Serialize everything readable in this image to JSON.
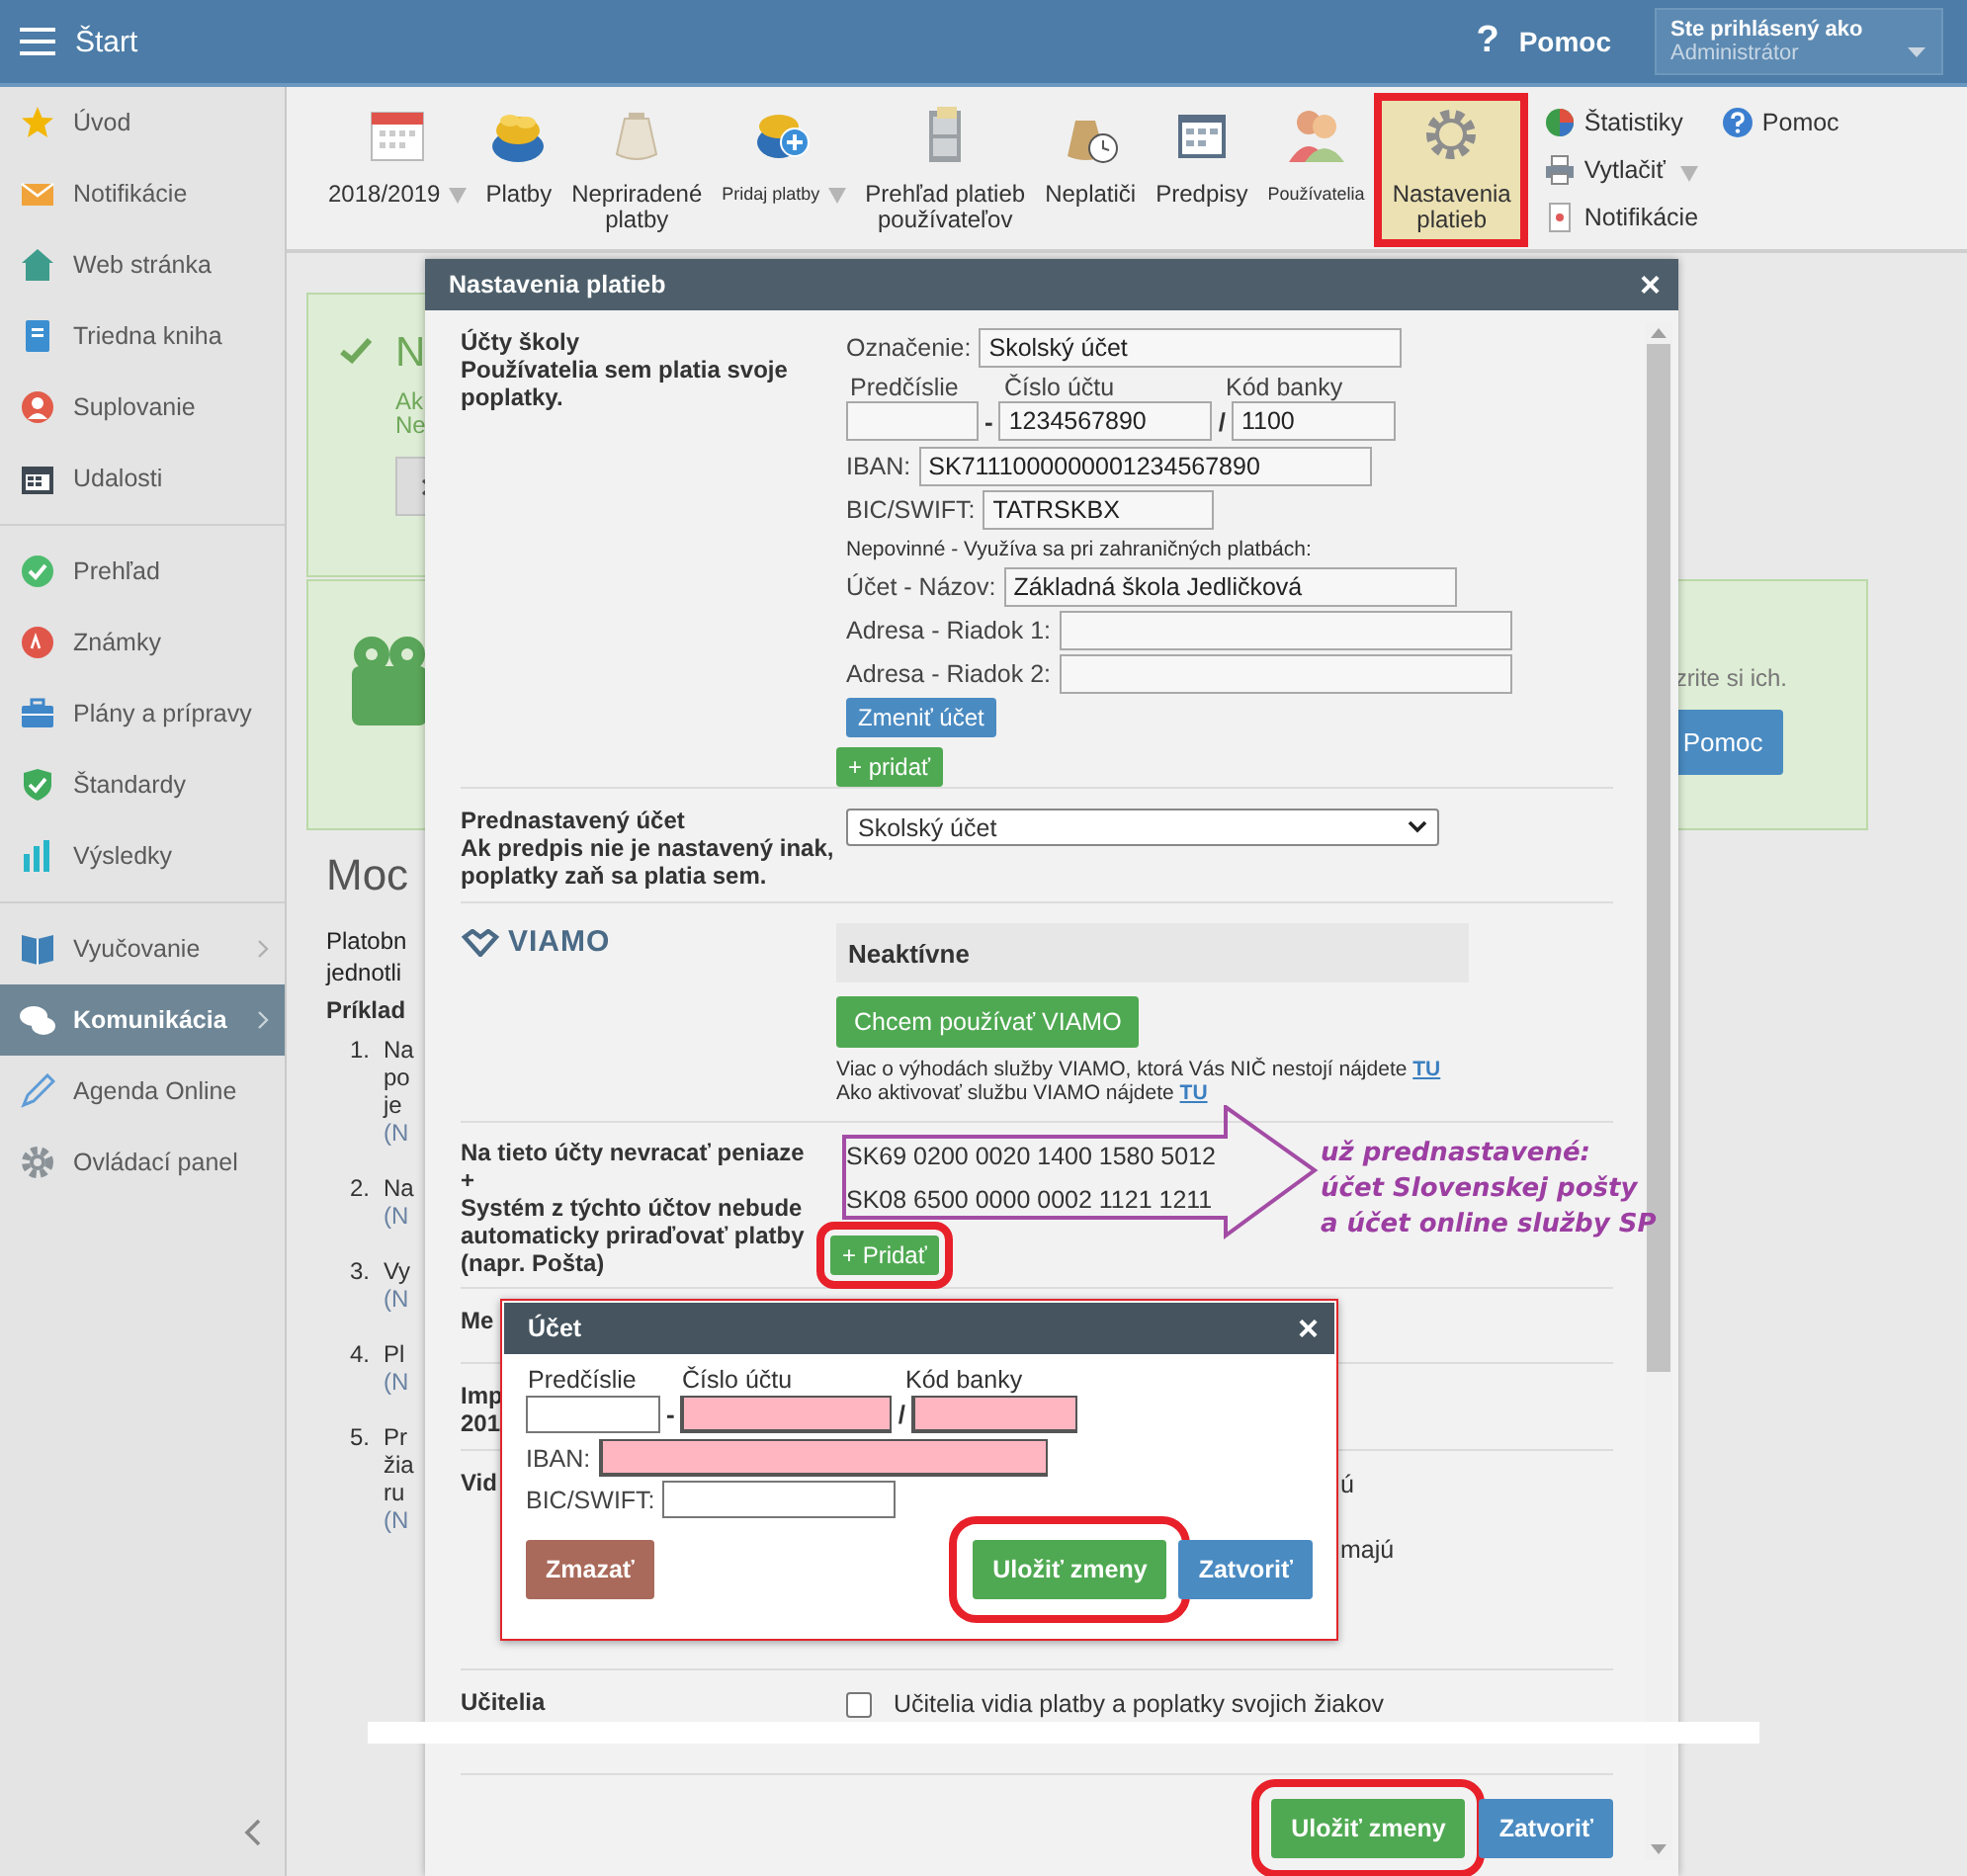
{
  "topbar": {
    "title": "Štart",
    "help_icon": "?",
    "help": "Pomoc",
    "user_label": "Ste prihlásený ako",
    "user_name": "Administrátor"
  },
  "sidebar": {
    "groups": [
      [
        {
          "label": "Úvod",
          "selected": false,
          "expandable": false
        },
        {
          "label": "Notifikácie",
          "selected": false,
          "expandable": false
        },
        {
          "label": "Web stránka",
          "selected": false,
          "expandable": false
        },
        {
          "label": "Triedna kniha",
          "selected": false,
          "expandable": false
        },
        {
          "label": "Suplovanie",
          "selected": false,
          "expandable": false
        },
        {
          "label": "Udalosti",
          "selected": false,
          "expandable": false
        }
      ],
      [
        {
          "label": "Prehľad",
          "selected": false,
          "expandable": false
        },
        {
          "label": "Známky",
          "selected": false,
          "expandable": false
        },
        {
          "label": "Plány a prípravy",
          "selected": false,
          "expandable": false
        },
        {
          "label": "Štandardy",
          "selected": false,
          "expandable": false
        },
        {
          "label": "Výsledky",
          "selected": false,
          "expandable": false
        }
      ],
      [
        {
          "label": "Vyučovanie",
          "selected": false,
          "expandable": true
        },
        {
          "label": "Komunikácia",
          "selected": true,
          "expandable": true
        },
        {
          "label": "Agenda Online",
          "selected": false,
          "expandable": false
        },
        {
          "label": "Ovládací panel",
          "selected": false,
          "expandable": false
        }
      ]
    ]
  },
  "toolbar": {
    "items": [
      {
        "label": "2018/2019",
        "dropdown": true,
        "selected": false,
        "small": false
      },
      {
        "label": "Platby",
        "dropdown": false,
        "selected": false,
        "small": false
      },
      {
        "label": "Nepriradené\nplatby",
        "dropdown": false,
        "selected": false,
        "small": false
      },
      {
        "label": "Pridaj platby",
        "dropdown": true,
        "selected": false,
        "small": true
      },
      {
        "label": "Prehľad platieb\npoužívateľov",
        "dropdown": false,
        "selected": false,
        "small": false
      },
      {
        "label": "Neplatiči",
        "dropdown": false,
        "selected": false,
        "small": false
      },
      {
        "label": "Predpisy",
        "dropdown": false,
        "selected": false,
        "small": false
      },
      {
        "label": "Používatelia",
        "dropdown": false,
        "selected": false,
        "small": true
      },
      {
        "label": "Nastavenia\nplatieb",
        "dropdown": false,
        "selected": true,
        "small": false
      }
    ],
    "side_items": [
      {
        "label": "Štatistiky",
        "dropdown": false
      },
      {
        "label": "Pomoc",
        "dropdown": false
      },
      {
        "label": "Vytlačiť",
        "dropdown": true
      },
      {
        "label": "Notifikácie",
        "dropdown": false
      }
    ]
  },
  "background": {
    "notice": {
      "title": "N",
      "lines": [
        "Ak",
        "Ne"
      ]
    },
    "banner": {
      "text": "zrite si ich.",
      "button": "Pomoc"
    },
    "heading": "Moc",
    "paragraph": [
      "Platobn",
      "jednotli"
    ],
    "examples_title": "Príklad",
    "examples": [
      {
        "number": "1.",
        "lines": [
          "Na",
          "po",
          "je"
        ],
        "note": "(N"
      },
      {
        "number": "2.",
        "lines": [
          "Na"
        ],
        "note": "(N"
      },
      {
        "number": "3.",
        "lines": [
          "Vy"
        ],
        "note": "(N"
      },
      {
        "number": "4.",
        "lines": [
          "Pl"
        ],
        "note": "(N"
      },
      {
        "number": "5.",
        "lines": [
          "Pr",
          "žia",
          "ru"
        ],
        "note": "(N"
      }
    ]
  },
  "dialog": {
    "title": "Nastavenia platieb",
    "close": "×",
    "accounts": {
      "title": "Účty školy",
      "subtitle": "Používatelia sem platia svoje poplatky.",
      "name_field": {
        "label": "Označenie:",
        "value": "Skolský účet"
      },
      "number_fields": [
        {
          "label": "Predčíslie"
        },
        {
          "label": "Číslo účtu",
          "value": "1234567890"
        },
        {
          "label": "Kód banky",
          "value": "1100"
        }
      ],
      "separators": [
        "-",
        "/"
      ],
      "iban": {
        "label": "IBAN:",
        "value": "SK7111000000001234567890"
      },
      "bic": {
        "label": "BIC/SWIFT:",
        "value": "TATRSKBX"
      },
      "optional_note": "Nepovinné - Využíva sa pri zahraničných platbách:",
      "extra_fields": [
        {
          "label": "Účet - Názov:",
          "value": "Základná škola Jedličková"
        },
        {
          "label": "Adresa - Riadok 1:"
        },
        {
          "label": "Adresa - Riadok 2:"
        }
      ],
      "change_button": "Zmeniť účet",
      "add_button": "+ pridať"
    },
    "default_account": {
      "title": "Prednastavený účet",
      "subtitle": "Ak predpis nie je nastavený inak, poplatky zaň sa platia sem.",
      "value": "Skolský účet"
    },
    "viamo": {
      "logo": "VIAMO",
      "status": "Neaktívne",
      "button": "Chcem používať VIAMO",
      "info": [
        {
          "text": "Viac o výhodách služby VIAMO, ktorá Vás NIČ nestojí nájdete ",
          "link": "TU"
        },
        {
          "text": "Ako aktivovať službu VIAMO nájdete ",
          "link": "TU"
        }
      ]
    },
    "excluded": {
      "title": "Na tieto účty nevracať peniaze",
      "plus": "+",
      "description": "Systém z týchto účtov nebude automaticky priraďovať platby (napr. Pošta)",
      "accounts": [
        "SK69 0200 0020 1400 1580 5012",
        "SK08 6500 0000 0002 1121 1211"
      ],
      "add_button": "+ Pridať"
    },
    "hidden_rows": [
      {
        "label": [
          "Me"
        ],
        "fragments": []
      },
      {
        "label": [
          "Imp",
          "201"
        ],
        "fragments": []
      },
      {
        "label": [
          "Vid"
        ],
        "fragments": [
          "ú",
          "majú"
        ]
      }
    ],
    "teachers": {
      "title": "Učitelia",
      "checked": false,
      "text": "Učitelia vidia platby a poplatky svojich žiakov"
    },
    "save_button": "Uložiť zmeny",
    "close_button": "Zatvoriť"
  },
  "account_dialog": {
    "title": "Účet",
    "close": "×",
    "fields": [
      {
        "label": "Predčíslie",
        "invalid": false
      },
      {
        "label": "Číslo účtu",
        "invalid": true
      },
      {
        "label": "Kód banky",
        "invalid": true
      }
    ],
    "separators": [
      "-",
      "/"
    ],
    "iban": {
      "label": "IBAN:",
      "invalid": true
    },
    "bic": {
      "label": "BIC/SWIFT:",
      "invalid": false
    },
    "delete_button": "Zmazať",
    "save_button": "Uložiť zmeny",
    "close_button": "Zatvoriť"
  },
  "annotation": {
    "lines": [
      "už prednastavené:",
      "účet Slovenskej pošty",
      "a účet online služby SP"
    ]
  }
}
